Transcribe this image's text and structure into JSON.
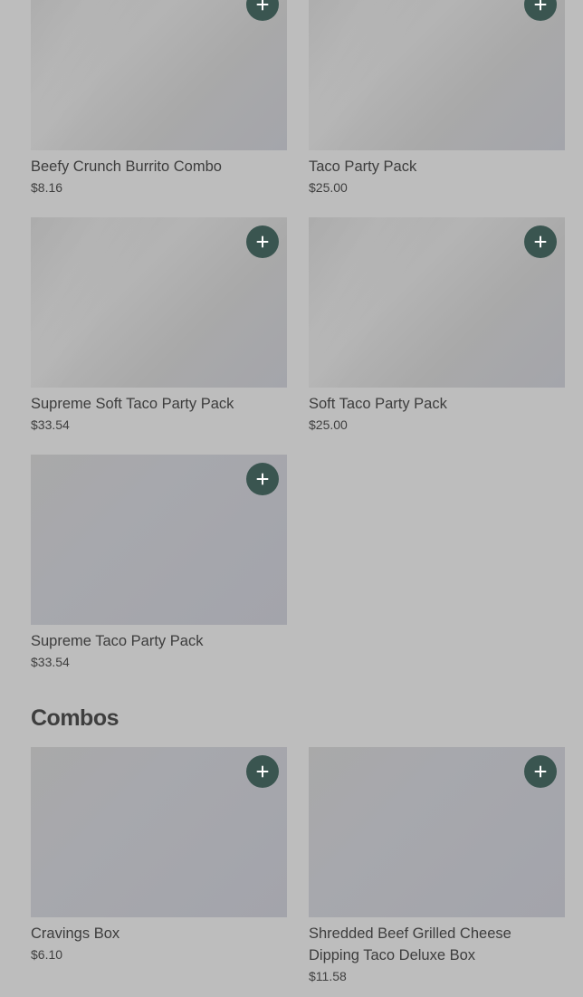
{
  "party_packs": [
    {
      "title": "Beefy Crunch Burrito Combo",
      "price": "$8.16"
    },
    {
      "title": "Taco Party Pack",
      "price": "$25.00"
    },
    {
      "title": "Supreme Soft Taco Party Pack",
      "price": "$33.54"
    },
    {
      "title": "Soft Taco Party Pack",
      "price": "$25.00"
    },
    {
      "title": "Supreme Taco Party Pack",
      "price": "$33.54"
    }
  ],
  "combos": {
    "heading": "Combos",
    "items": [
      {
        "title": "Cravings Box",
        "price": "$6.10"
      },
      {
        "title": "Shredded Beef Grilled Cheese Dipping Taco Deluxe Box",
        "price": "$11.58"
      }
    ]
  },
  "icons": {
    "add": "plus-icon"
  },
  "colors": {
    "background": "#bdbdbd",
    "add_button": "#3a5550",
    "text": "#3d3d3d"
  }
}
